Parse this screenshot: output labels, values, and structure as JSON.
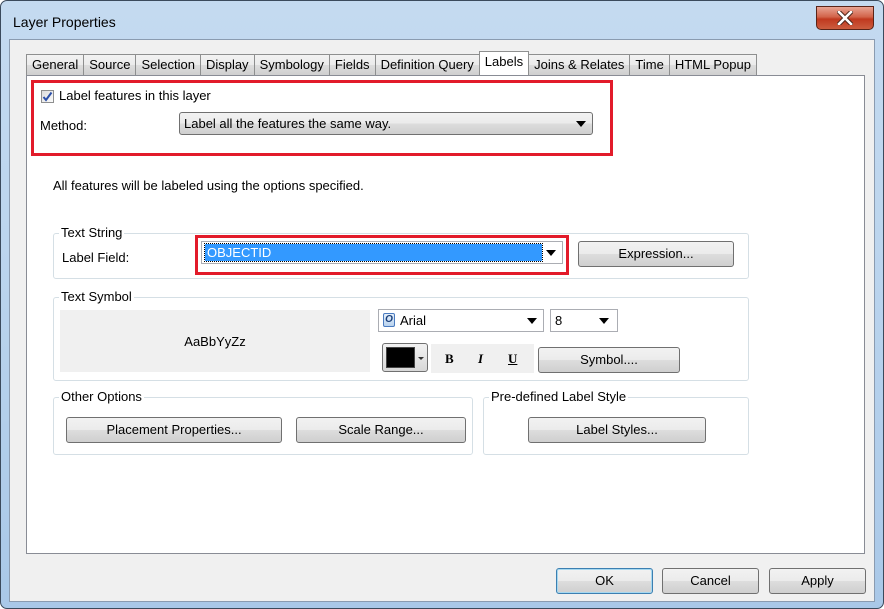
{
  "window": {
    "title": "Layer Properties",
    "close_icon": "close-x-icon"
  },
  "tabs": [
    {
      "label": "General",
      "active": false
    },
    {
      "label": "Source",
      "active": false
    },
    {
      "label": "Selection",
      "active": false
    },
    {
      "label": "Display",
      "active": false
    },
    {
      "label": "Symbology",
      "active": false
    },
    {
      "label": "Fields",
      "active": false
    },
    {
      "label": "Definition Query",
      "active": false
    },
    {
      "label": "Labels",
      "active": true
    },
    {
      "label": "Joins & Relates",
      "active": false
    },
    {
      "label": "Time",
      "active": false
    },
    {
      "label": "HTML Popup",
      "active": false
    }
  ],
  "labels_tab": {
    "label_features_checkbox": {
      "label": "Label features in this layer",
      "checked": true
    },
    "method": {
      "label": "Method:",
      "value": "Label all the features the same way."
    },
    "info_text": "All features will be labeled using the options specified.",
    "text_string": {
      "group_title": "Text String",
      "label_field_label": "Label Field:",
      "label_field_value": "OBJECTID",
      "expression_button": "Expression..."
    },
    "text_symbol": {
      "group_title": "Text Symbol",
      "preview_text": "AaBbYyZz",
      "font": "Arial",
      "font_icon": "opentype-font-icon",
      "size": "8",
      "color": "#000000",
      "bold_label": "B",
      "italic_label": "I",
      "underline_label": "U",
      "symbol_button": "Symbol...."
    },
    "other_options": {
      "group_title": "Other Options",
      "placement_button": "Placement Properties...",
      "scale_range_button": "Scale Range..."
    },
    "predefined_style": {
      "group_title": "Pre-defined Label Style",
      "label_styles_button": "Label Styles..."
    }
  },
  "footer": {
    "ok": "OK",
    "cancel": "Cancel",
    "apply": "Apply"
  },
  "highlight_color": "#e21b2a",
  "selection_color": "#3399ff"
}
